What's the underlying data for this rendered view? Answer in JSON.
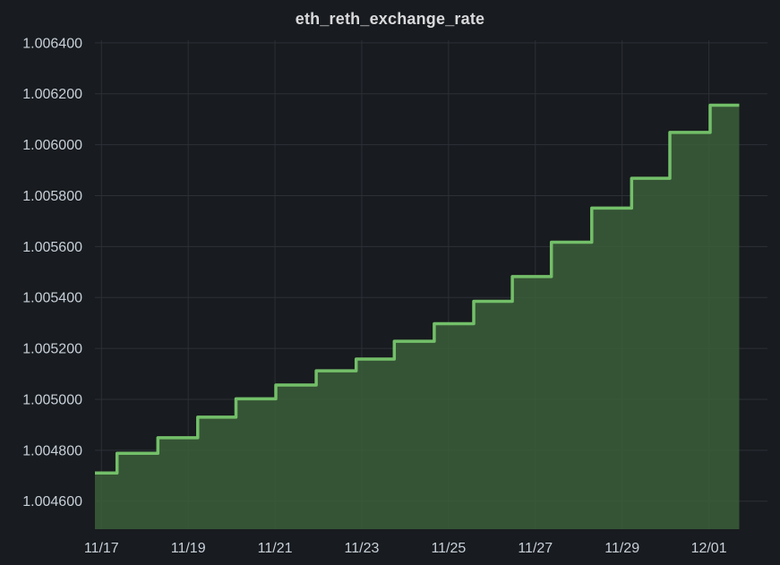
{
  "panel": {
    "title": "eth_reth_exchange_rate"
  },
  "colors": {
    "background": "#181b1f",
    "grid": "#2c3037",
    "line": "#73bf69",
    "fill": "#3b5e3a",
    "text": "#c7d0d9"
  },
  "chart_data": {
    "type": "area",
    "title": "eth_reth_exchange_rate",
    "xlabel": "",
    "ylabel": "",
    "x_unit": "days since 11/17 00:00",
    "xlim": [
      -0.15,
      15.35
    ],
    "ylim": [
      1.00449,
      1.00641
    ],
    "grid": true,
    "legend": "none",
    "y_ticks": [
      "1.004600",
      "1.004800",
      "1.005000",
      "1.005200",
      "1.005400",
      "1.005600",
      "1.005800",
      "1.006000",
      "1.006200",
      "1.006400"
    ],
    "y_tick_values": [
      1.0046,
      1.0048,
      1.005,
      1.0052,
      1.0054,
      1.0056,
      1.0058,
      1.006,
      1.0062,
      1.0064
    ],
    "x_ticks": [
      "11/17",
      "11/19",
      "11/21",
      "11/23",
      "11/25",
      "11/27",
      "11/29",
      "12/01"
    ],
    "x_tick_values": [
      0,
      2,
      4,
      6,
      8,
      10,
      12,
      14
    ],
    "series": [
      {
        "name": "eth_reth_exchange_rate",
        "step": true,
        "x": [
          -0.15,
          0.36,
          1.3,
          2.22,
          3.1,
          4.02,
          4.95,
          5.87,
          6.75,
          7.67,
          8.58,
          9.47,
          10.37,
          11.3,
          12.22,
          13.1,
          14.03,
          14.7
        ],
        "values": [
          1.004711,
          1.004788,
          1.004849,
          1.00493,
          1.005002,
          1.005056,
          1.005112,
          1.005158,
          1.005228,
          1.005297,
          1.005385,
          1.005482,
          1.005617,
          1.005751,
          1.005868,
          1.006048,
          1.006155,
          1.006155
        ]
      }
    ]
  }
}
